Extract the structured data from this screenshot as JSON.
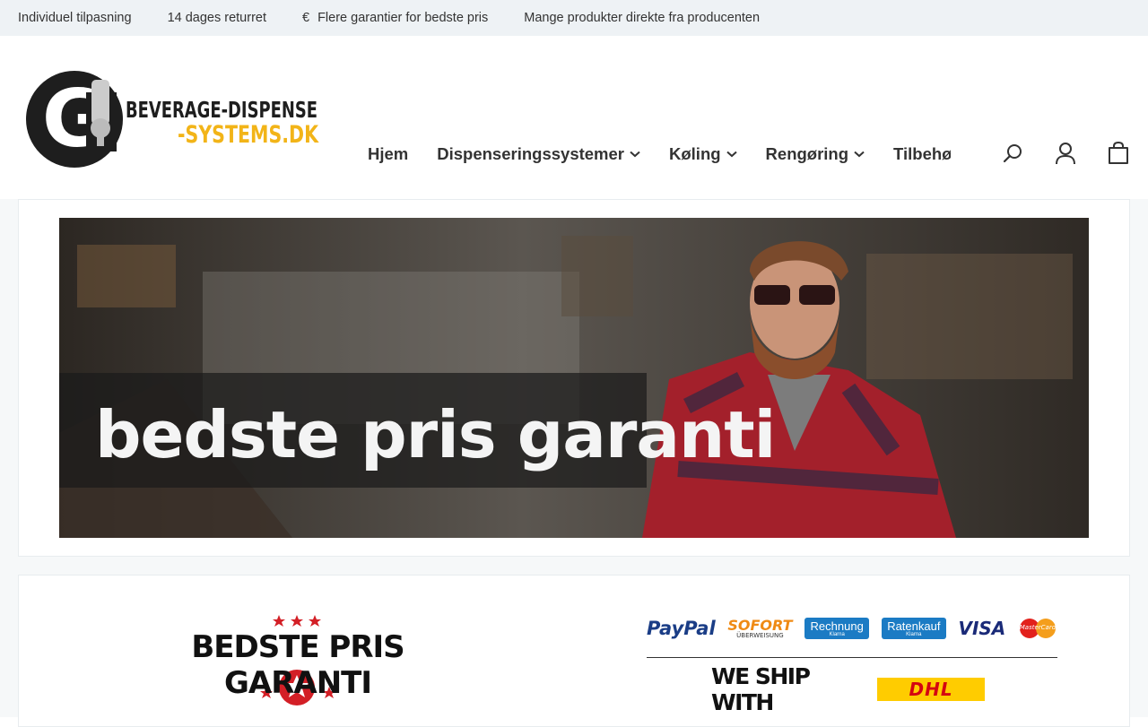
{
  "topbar": {
    "usps": [
      {
        "label": "Individuel tilpasning"
      },
      {
        "label": "14 dages returret"
      },
      {
        "icon": "euro-icon",
        "label": "Flere garantier for bedste pris"
      },
      {
        "label": "Mange produkter direkte fra producenten"
      }
    ]
  },
  "logo": {
    "line1": "BEVERAGE-DISPENSE",
    "line2": "-SYSTEMS.DK",
    "initial": "G",
    "colors": {
      "dark": "#1e1e1e",
      "accent": "#f2b418"
    }
  },
  "nav": {
    "items": [
      {
        "label": "Hjem",
        "has_dropdown": false
      },
      {
        "label": "Dispenseringssystemer",
        "has_dropdown": true
      },
      {
        "label": "Køling",
        "has_dropdown": true
      },
      {
        "label": "Rengøring",
        "has_dropdown": true
      },
      {
        "label": "Tilbehør",
        "has_dropdown": false
      }
    ]
  },
  "header_icons": [
    "search-icon",
    "account-icon",
    "cart-icon"
  ],
  "banner": {
    "text": "bedste pris garanti"
  },
  "guarantee": {
    "title": "BEDSTE PRIS GARANTI"
  },
  "payments": {
    "methods": [
      {
        "label": "PayPal"
      },
      {
        "label": "SOFORT",
        "sublabel": "ÜBERWEISUNG"
      },
      {
        "label": "Rechnung",
        "sublabel": "Klarna"
      },
      {
        "label": "Ratenkauf",
        "sublabel": "Klarna"
      },
      {
        "label": "VISA"
      },
      {
        "label": "MasterCard"
      }
    ],
    "shipping_text": "WE SHIP WITH",
    "carrier": "DHL"
  }
}
